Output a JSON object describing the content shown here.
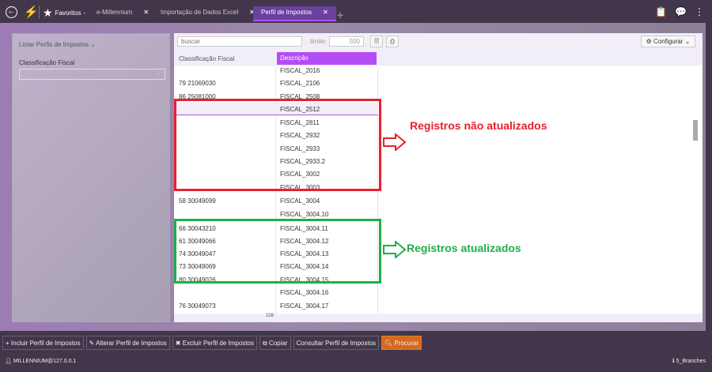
{
  "topbar": {
    "favorites": "Favoritos",
    "tabs": [
      {
        "label": "e-Millennium"
      },
      {
        "label": "Importação de Dados Excel"
      },
      {
        "label": "Perfil de Impostos",
        "active": true
      }
    ]
  },
  "left_panel": {
    "title": "Listar Perfis de Impostos",
    "field_label": "Classificação Fiscal",
    "field_value": ""
  },
  "grid": {
    "search_placeholder": "buscar",
    "limit_label": "limite:",
    "limit_value": "500",
    "configure_label": "Configurar",
    "columns": [
      "Classificação Fiscal",
      "Descrição"
    ],
    "rows": [
      [
        "",
        "FISCAL_2016"
      ],
      [
        "79 21069030",
        "FISCAL_2106"
      ],
      [
        "86 25081000",
        "FISCAL_2508"
      ],
      [
        "",
        "FISCAL_2512"
      ],
      [
        "",
        "FISCAL_2811"
      ],
      [
        "",
        "FISCAL_2932"
      ],
      [
        "",
        "FISCAL_2933"
      ],
      [
        "",
        "FISCAL_2933.2"
      ],
      [
        "",
        "FISCAL_3002"
      ],
      [
        "",
        "FISCAL_3003"
      ],
      [
        "58 30049099",
        "FISCAL_3004"
      ],
      [
        "",
        "FISCAL_3004.10"
      ],
      [
        "66 30043210",
        "FISCAL_3004.11"
      ],
      [
        "61 30049066",
        "FISCAL_3004.12"
      ],
      [
        "74 30049047",
        "FISCAL_3004.13"
      ],
      [
        "73 30049069",
        "FISCAL_3004.14"
      ],
      [
        "80 30049026",
        "FISCAL_3004.15"
      ],
      [
        "",
        "FISCAL_3004.16"
      ],
      [
        "76 30049073",
        "FISCAL_3004.17"
      ]
    ],
    "selected_row": 3,
    "total_count": "228"
  },
  "annotations": {
    "red": "Registros não atualizados",
    "green": "Registros atualizados",
    "red_color": "#e8202e",
    "green_color": "#1fae4a"
  },
  "toolbar": [
    "Incluir Perfil de Impostos",
    "Alterar Perfil de Impostos",
    "Excluir Perfil de Impostos",
    "Copiar",
    "Consultar Perfil de Impostos",
    "Procurar"
  ],
  "status": {
    "user": "MILLENNIUM@127.0.0.1",
    "branch": "5_Branches"
  }
}
